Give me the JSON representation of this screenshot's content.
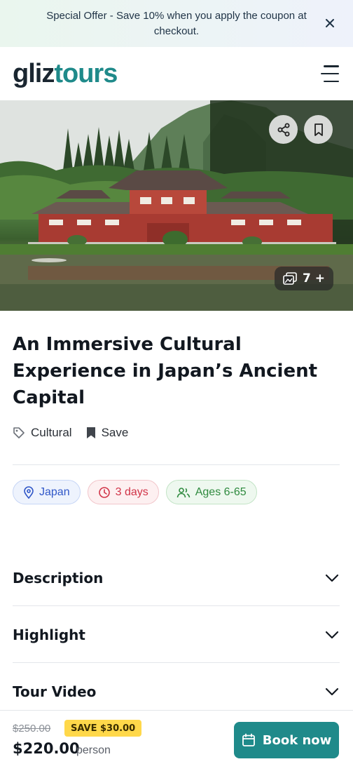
{
  "banner": {
    "text": "Special Offer - Save 10% when you apply the coupon at checkout."
  },
  "header": {
    "logo_part1": "gliz",
    "logo_part2": "tours"
  },
  "hero": {
    "gallery_count": "7 +",
    "icons": [
      "share-icon",
      "bookmark-icon",
      "gallery-icon"
    ]
  },
  "tour": {
    "title": "An Immersive Cultural Experience in Japan’s Ancient Capital",
    "category": "Cultural",
    "save_label": "Save",
    "chips": {
      "location": "Japan",
      "duration": "3 days",
      "ages": "Ages 6-65"
    }
  },
  "sections": [
    {
      "label": "Description"
    },
    {
      "label": "Highlight"
    },
    {
      "label": "Tour Video"
    }
  ],
  "booking": {
    "old_price": "$250.00",
    "save_badge": "SAVE $30.00",
    "price": "$220.00",
    "per": "person",
    "book_label": "Book now"
  },
  "colors": {
    "brand": "#1f8a8a",
    "save_badge": "#ffd84a",
    "chip_blue": "#3057c8",
    "chip_red": "#d13448",
    "chip_green": "#2e8a3e"
  }
}
